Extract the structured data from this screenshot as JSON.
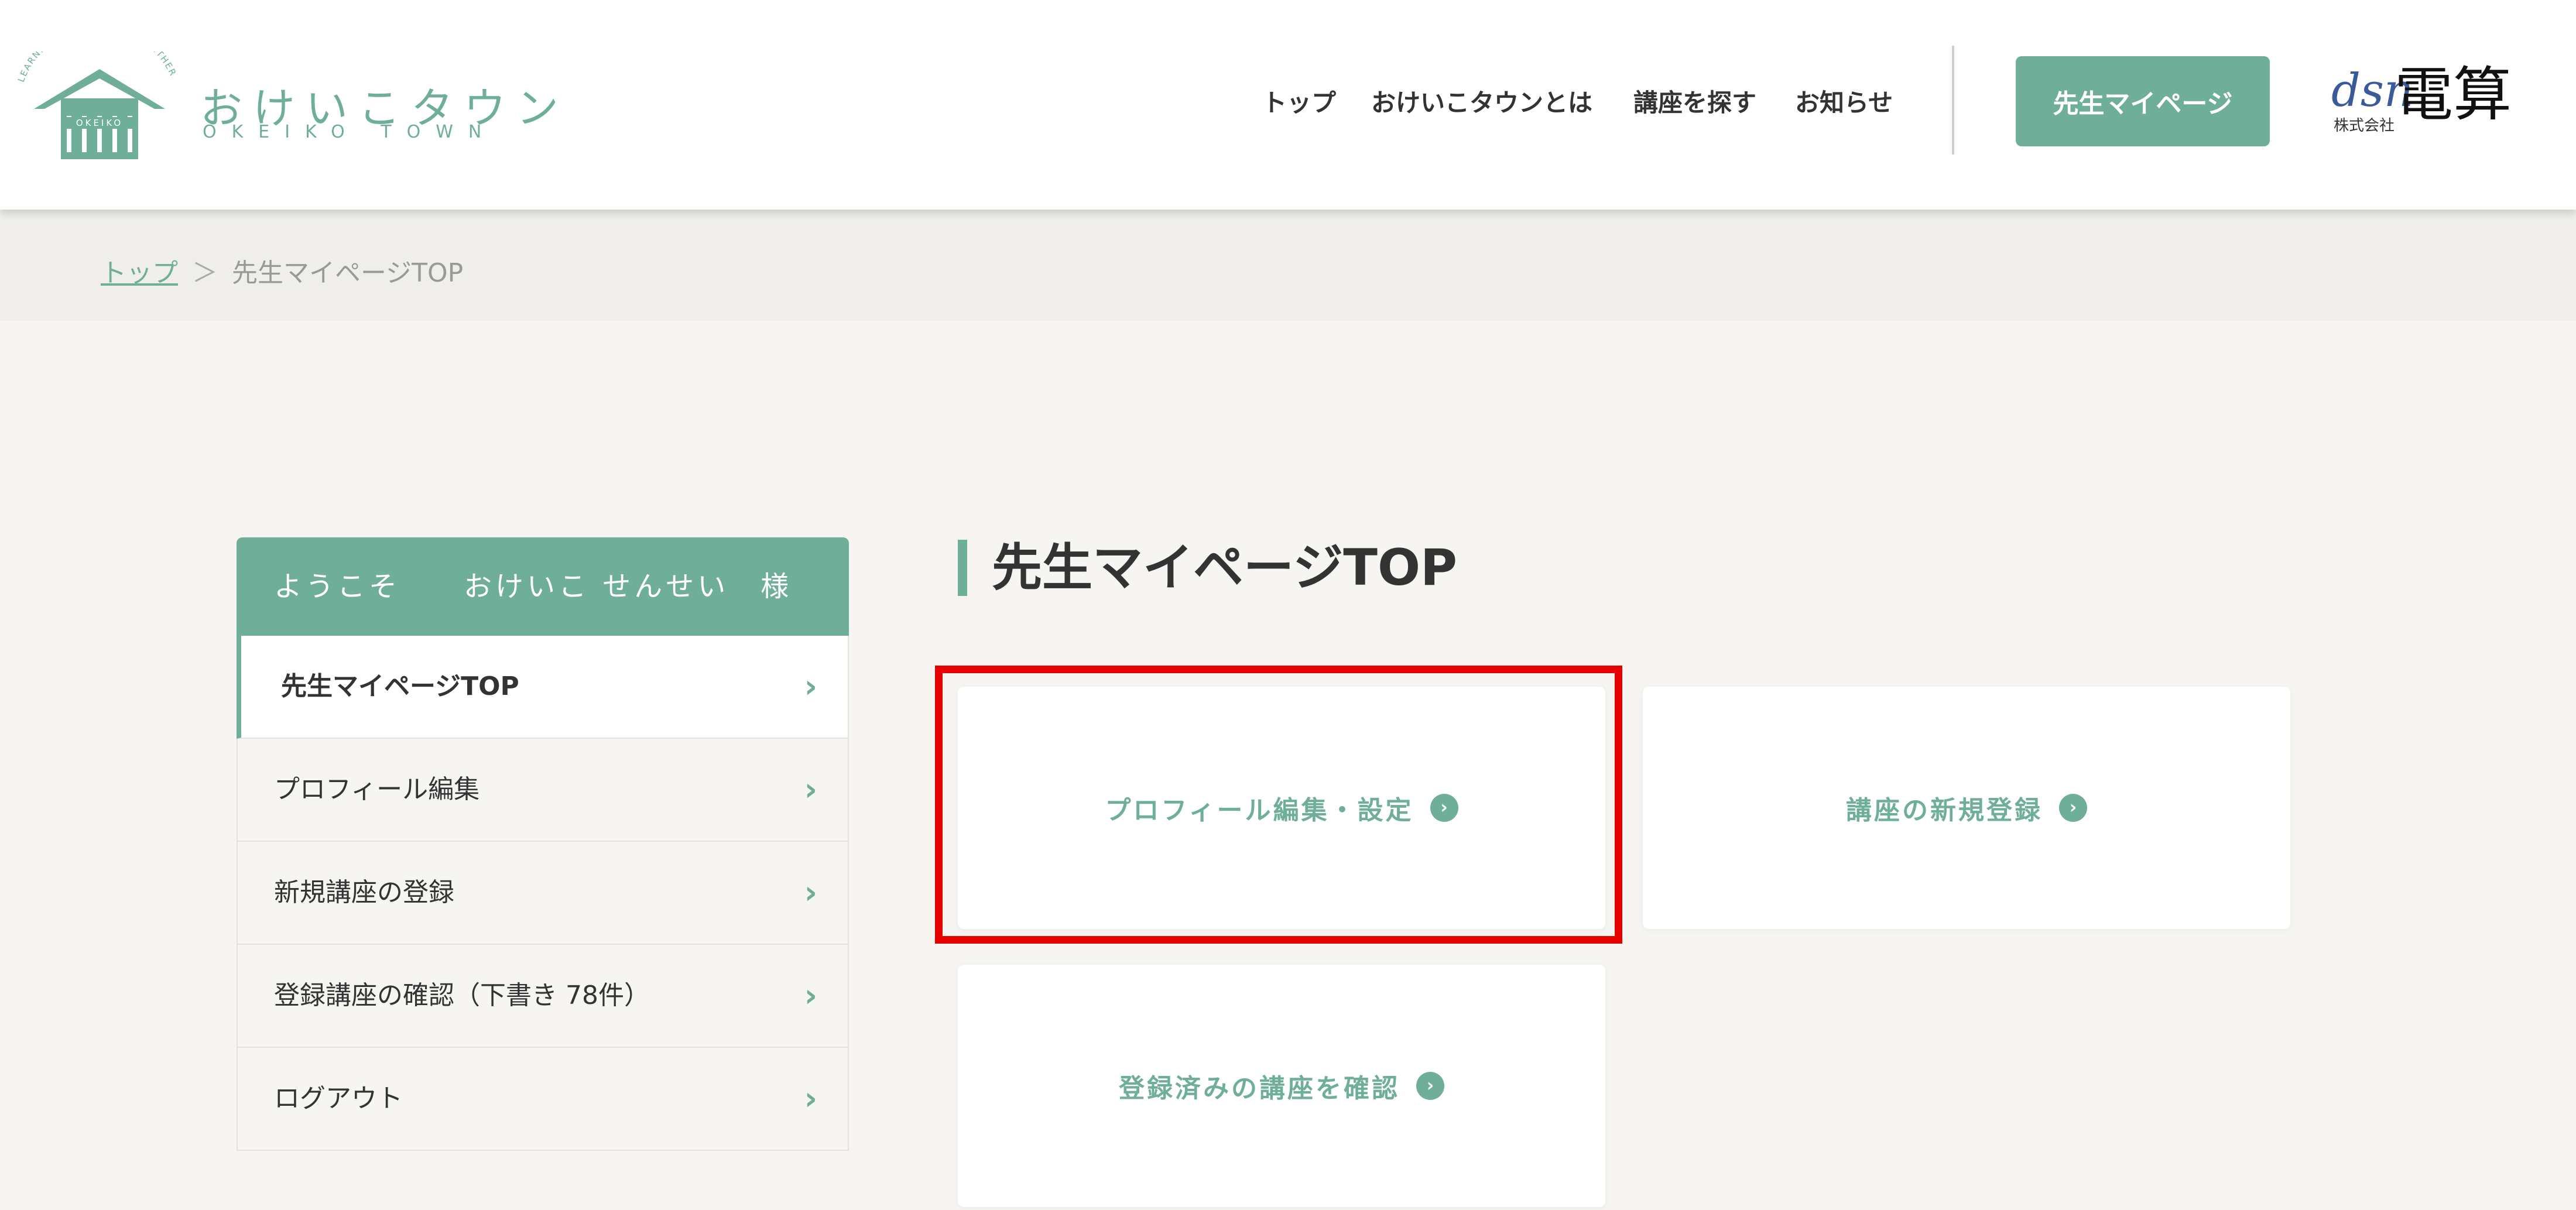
{
  "header": {
    "logo": {
      "text": "おけいこタウン",
      "subtext": "OKEIKO TOWN",
      "arc_text": "LEARNING · TEACHING · TOGETHER",
      "sign_text": "OKEIKO"
    },
    "nav": [
      {
        "label": "トップ"
      },
      {
        "label": "おけいこタウンとは"
      },
      {
        "label": "講座を探す"
      },
      {
        "label": "お知らせ"
      }
    ],
    "cta_label": "先生マイページ",
    "partner": {
      "dsn": "dsn",
      "kk": "株式会社",
      "name": "電算"
    }
  },
  "breadcrumb": {
    "home": "トップ",
    "separator": "＞",
    "current": "先生マイページTOP"
  },
  "sidebar": {
    "welcome": "ようこそ　　おけいこ せんせい　様",
    "items": [
      {
        "label": "先生マイページTOP"
      },
      {
        "label": "プロフィール編集"
      },
      {
        "label": "新規講座の登録"
      },
      {
        "label": "登録講座の確認（下書き 78件）"
      },
      {
        "label": "ログアウト"
      }
    ]
  },
  "main": {
    "title": "先生マイページTOP",
    "cards": [
      {
        "label": "プロフィール編集・設定"
      },
      {
        "label": "講座の新規登録"
      },
      {
        "label": "登録済みの講座を確認"
      }
    ]
  },
  "colors": {
    "accent": "#6fae98",
    "highlight": "#e60000",
    "background": "#f6f5f1"
  },
  "icons": {
    "chevron": "chevron-right-icon",
    "card_arrow": "circle-arrow-right-icon",
    "logo": "house-icon"
  }
}
